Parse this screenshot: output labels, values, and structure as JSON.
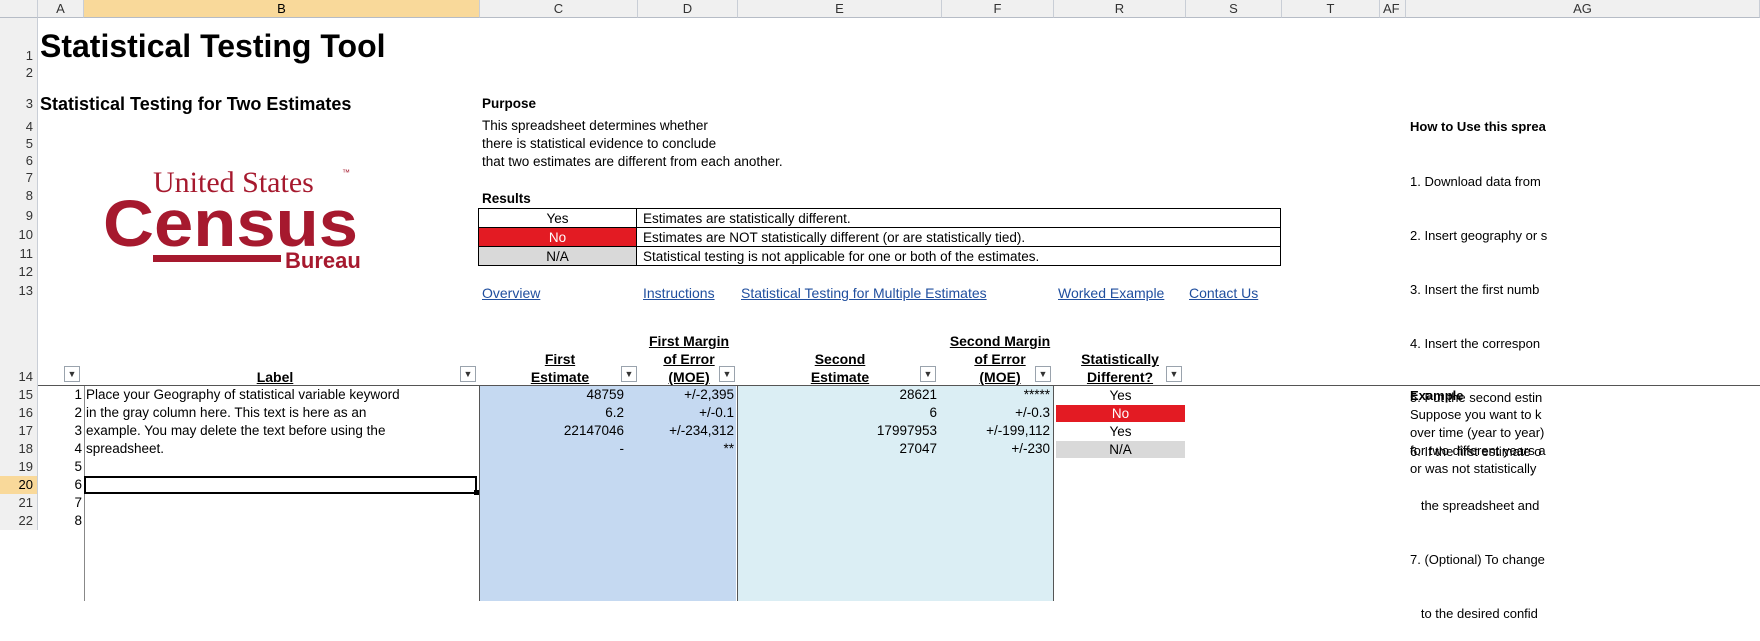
{
  "columns": [
    "A",
    "B",
    "C",
    "D",
    "E",
    "F",
    "R",
    "S",
    "T",
    "AF",
    "AG"
  ],
  "rows": [
    "1",
    "2",
    "3",
    "4",
    "5",
    "6",
    "7",
    "8",
    "9",
    "10",
    "11",
    "12",
    "13",
    "14",
    "15",
    "16",
    "17",
    "18",
    "19",
    "20",
    "21",
    "22"
  ],
  "title": "Statistical Testing Tool",
  "subtitle": "Statistical Testing for Two Estimates",
  "logo": {
    "line1": "United States",
    "tm": "™",
    "line2": "Census",
    "line3": "Bureau",
    "color": "#a6192e"
  },
  "purpose": {
    "heading": "Purpose",
    "lines": [
      "This spreadsheet determines whether",
      "there is statistical evidence to conclude",
      "that two estimates are different from each another."
    ]
  },
  "results": {
    "heading": "Results",
    "rows": [
      {
        "key": "Yes",
        "desc": "Estimates are statistically different."
      },
      {
        "key": "No",
        "desc": "Estimates are NOT statistically different (or are statistically tied)."
      },
      {
        "key": "N/A",
        "desc": "Statistical testing is not applicable for one or both of the estimates."
      }
    ]
  },
  "links": [
    "Overview",
    "Instructions",
    "Statistical Testing for Multiple Estimates",
    "Worked Example",
    "Contact Us"
  ],
  "how_to": {
    "heading": "How to Use this sprea",
    "lines": [
      "1. Download data from",
      "2. Insert geography or s",
      "3. Insert the first numb",
      "4. Insert the correspon",
      "5. Put the second estin",
      "6. If the first estimate o",
      "   the spreadsheet and",
      "7. (Optional) To change",
      "   to the desired confid"
    ]
  },
  "table_headers": {
    "label": "Label",
    "first_estimate": [
      "First",
      "Estimate"
    ],
    "first_moe": [
      "First Margin",
      "of Error",
      "(MOE)"
    ],
    "second_estimate": [
      "Second",
      "Estimate"
    ],
    "second_moe": [
      "Second Margin",
      "of Error",
      "(MOE)"
    ],
    "stat_diff": [
      "Statistically",
      "Different?"
    ]
  },
  "table_rows": [
    {
      "n": "1",
      "label": "Place your Geography of statistical variable keyword",
      "e1": "48759",
      "m1": "+/-2,395",
      "e2": "28621",
      "m2": "*****",
      "diff": "Yes"
    },
    {
      "n": "2",
      "label": "in the gray column here. This text is here as an",
      "e1": "6.2",
      "m1": "+/-0.1",
      "e2": "6",
      "m2": "+/-0.3",
      "diff": "No"
    },
    {
      "n": "3",
      "label": "example. You may delete the text before using the",
      "e1": "22147046",
      "m1": "+/-234,312",
      "e2": "17997953",
      "m2": "+/-199,112",
      "diff": "Yes"
    },
    {
      "n": "4",
      "label": "spreadsheet.",
      "e1": "-",
      "m1": "**",
      "e2": "27047",
      "m2": "+/-230",
      "diff": "N/A"
    },
    {
      "n": "5",
      "label": "",
      "e1": "",
      "m1": "",
      "e2": "",
      "m2": "",
      "diff": ""
    },
    {
      "n": "6",
      "label": "",
      "e1": "",
      "m1": "",
      "e2": "",
      "m2": "",
      "diff": ""
    },
    {
      "n": "7",
      "label": "",
      "e1": "",
      "m1": "",
      "e2": "",
      "m2": "",
      "diff": ""
    },
    {
      "n": "8",
      "label": "",
      "e1": "",
      "m1": "",
      "e2": "",
      "m2": "",
      "diff": ""
    }
  ],
  "example": {
    "heading": "Example",
    "lines": [
      "Suppose you want to k",
      "over time (year to year)",
      "for two different years a",
      "or was not statistically"
    ]
  },
  "colors": {
    "red": "#e31b23",
    "gray": "#d9d9d9",
    "blue": "#c5d9f1",
    "teal": "#dbeef4",
    "link": "#1f4e9e"
  }
}
